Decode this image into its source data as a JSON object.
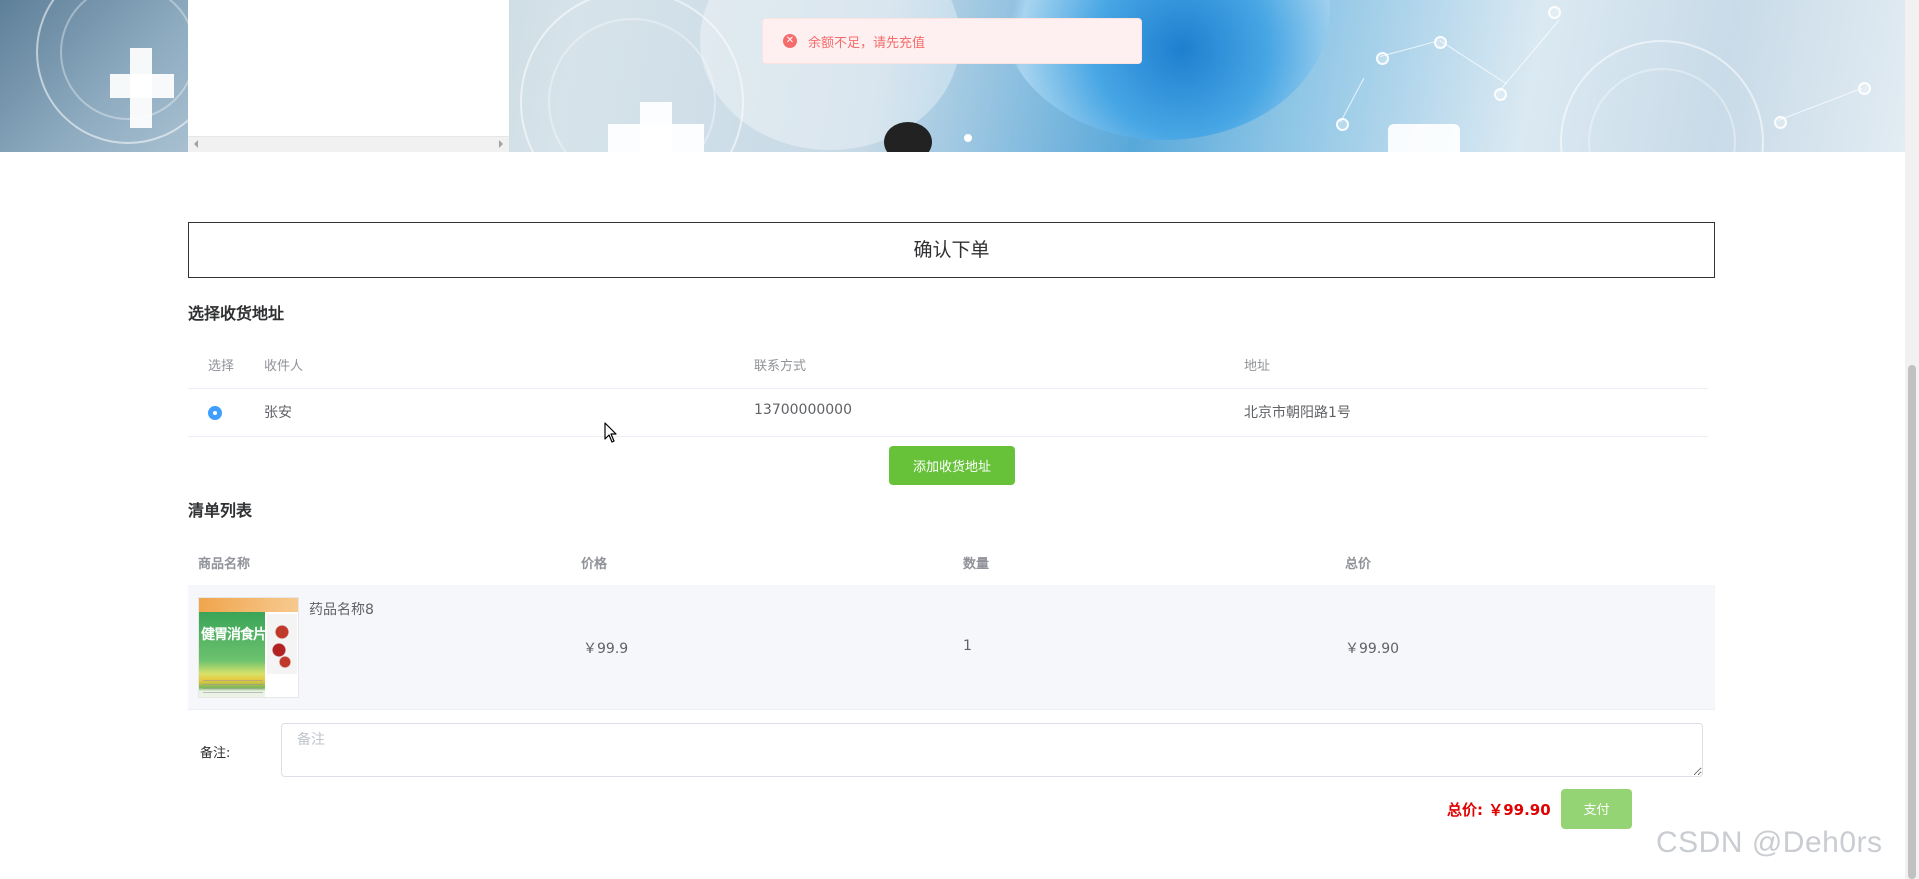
{
  "toast": {
    "icon": "error-circle-icon",
    "message": "余额不足，请先充值",
    "color": "#f56c6c"
  },
  "page_title": "确认下单",
  "address_section": {
    "title": "选择收货地址",
    "columns": [
      "选择",
      "收件人",
      "联系方式",
      "地址"
    ],
    "rows": [
      {
        "selected": true,
        "recipient": "张安",
        "phone": "13700000000",
        "address": "北京市朝阳路1号"
      }
    ],
    "add_button": "添加收货地址"
  },
  "list_section": {
    "title": "清单列表",
    "columns": [
      "商品名称",
      "价格",
      "数量",
      "总价"
    ],
    "rows": [
      {
        "name": "药品名称8",
        "image_text": "健胃消食片",
        "price": "￥99.9",
        "quantity": "1",
        "total": "￥99.90"
      }
    ]
  },
  "remark": {
    "label": "备注:",
    "placeholder": "备注",
    "value": ""
  },
  "summary": {
    "total_label": "总价: ￥99.90",
    "pay_button": "支付"
  },
  "colors": {
    "accent_green": "#67c23a",
    "pay_disabled_green": "#95d475",
    "price_red": "#e00000",
    "radio_blue": "#409eff"
  },
  "watermark": "CSDN @Deh0rs"
}
